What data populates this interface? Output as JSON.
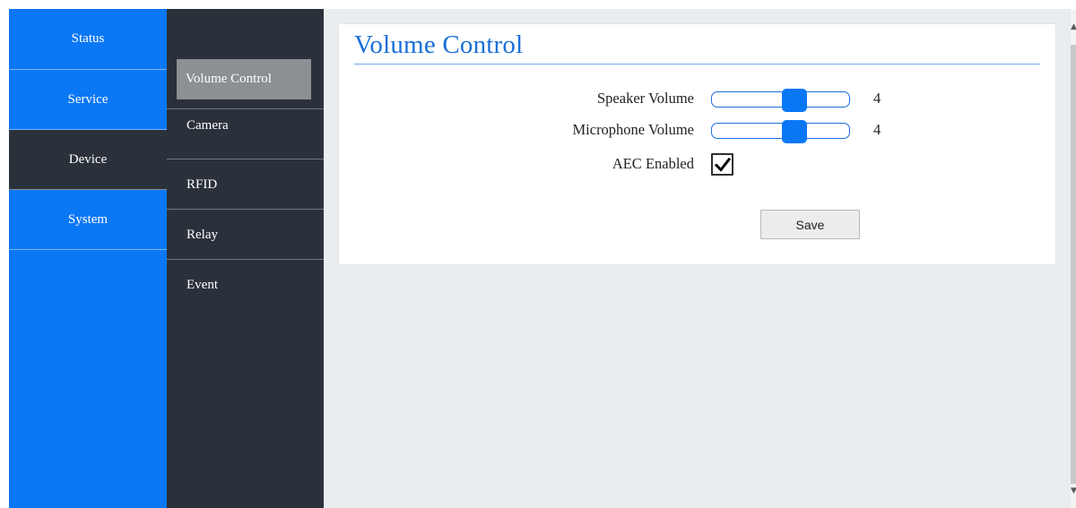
{
  "primary_nav": {
    "items": [
      {
        "label": "Status"
      },
      {
        "label": "Service"
      },
      {
        "label": "Device"
      },
      {
        "label": "System"
      }
    ],
    "active": "Device"
  },
  "secondary_nav": {
    "items": [
      {
        "label": "Volume Control"
      },
      {
        "label": "Camera"
      },
      {
        "label": "RFID"
      },
      {
        "label": "Relay"
      },
      {
        "label": "Event"
      }
    ],
    "active": "Volume Control"
  },
  "panel": {
    "title": "Volume Control",
    "speaker": {
      "label": "Speaker Volume",
      "value": "4",
      "level": 0.6
    },
    "microphone": {
      "label": "Microphone Volume",
      "value": "4",
      "level": 0.6
    },
    "aec": {
      "label": "AEC Enabled",
      "checked": true
    },
    "save_label": "Save"
  },
  "colors": {
    "primary_blue": "#0a77f5",
    "dark_nav": "#2b313b",
    "title_blue": "#1a6fd9"
  }
}
